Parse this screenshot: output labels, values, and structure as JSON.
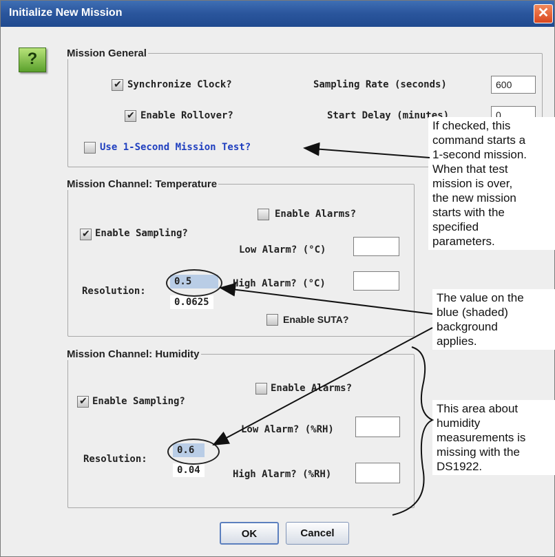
{
  "window": {
    "title": "Initialize New Mission"
  },
  "help_button": {
    "label": "?"
  },
  "mission_general": {
    "legend": "Mission General",
    "synchronize_clock": {
      "label": "Synchronize Clock?",
      "checked": true
    },
    "enable_rollover": {
      "label": "Enable Rollover?",
      "checked": true
    },
    "sampling_rate": {
      "label": "Sampling Rate (seconds)",
      "value": "600"
    },
    "start_delay": {
      "label": "Start Delay (minutes)",
      "value": "0"
    },
    "one_second_test": {
      "label": "Use 1-Second Mission Test?",
      "checked": false,
      "color": "#1f3fbf"
    }
  },
  "temperature": {
    "legend": "Mission Channel: Temperature",
    "enable_alarms": {
      "label": "Enable Alarms?",
      "checked": false
    },
    "enable_sampling": {
      "label": "Enable Sampling?",
      "checked": true
    },
    "low_alarm": {
      "label": "Low Alarm? (°C)",
      "value": ""
    },
    "high_alarm": {
      "label": "High Alarm? (°C)",
      "value": ""
    },
    "resolution": {
      "label": "Resolution:",
      "options": [
        "0.5",
        "0.0625"
      ],
      "selected": "0.5"
    },
    "enable_suta": {
      "label": "Enable SUTA?",
      "checked": false
    }
  },
  "humidity": {
    "legend": "Mission Channel: Humidity",
    "enable_alarms": {
      "label": "Enable Alarms?",
      "checked": false
    },
    "enable_sampling": {
      "label": "Enable Sampling?",
      "checked": true
    },
    "low_alarm": {
      "label": "Low Alarm? (%RH)",
      "value": ""
    },
    "high_alarm": {
      "label": "High Alarm? (%RH)",
      "value": ""
    },
    "resolution": {
      "label": "Resolution:",
      "options": [
        "0.6",
        "0.04"
      ],
      "selected": "0.6"
    }
  },
  "buttons": {
    "ok": "OK",
    "cancel": "Cancel"
  },
  "callouts": {
    "test_mission": [
      "If checked, this",
      "command starts a",
      "1-second mission.",
      "When that test",
      "mission is over,",
      "the new mission",
      "starts with the",
      "specified",
      "parameters."
    ],
    "resolution_note": [
      "The value on the",
      "blue (shaded)",
      "background",
      "applies."
    ],
    "humidity_note": [
      "This area about",
      "humidity",
      "measurements is",
      "missing with the",
      "DS1922."
    ]
  },
  "colors": {
    "selected_value_bg": "#b9cde6",
    "titlebar": "#2a559c",
    "help_button": "#5aa02c"
  }
}
